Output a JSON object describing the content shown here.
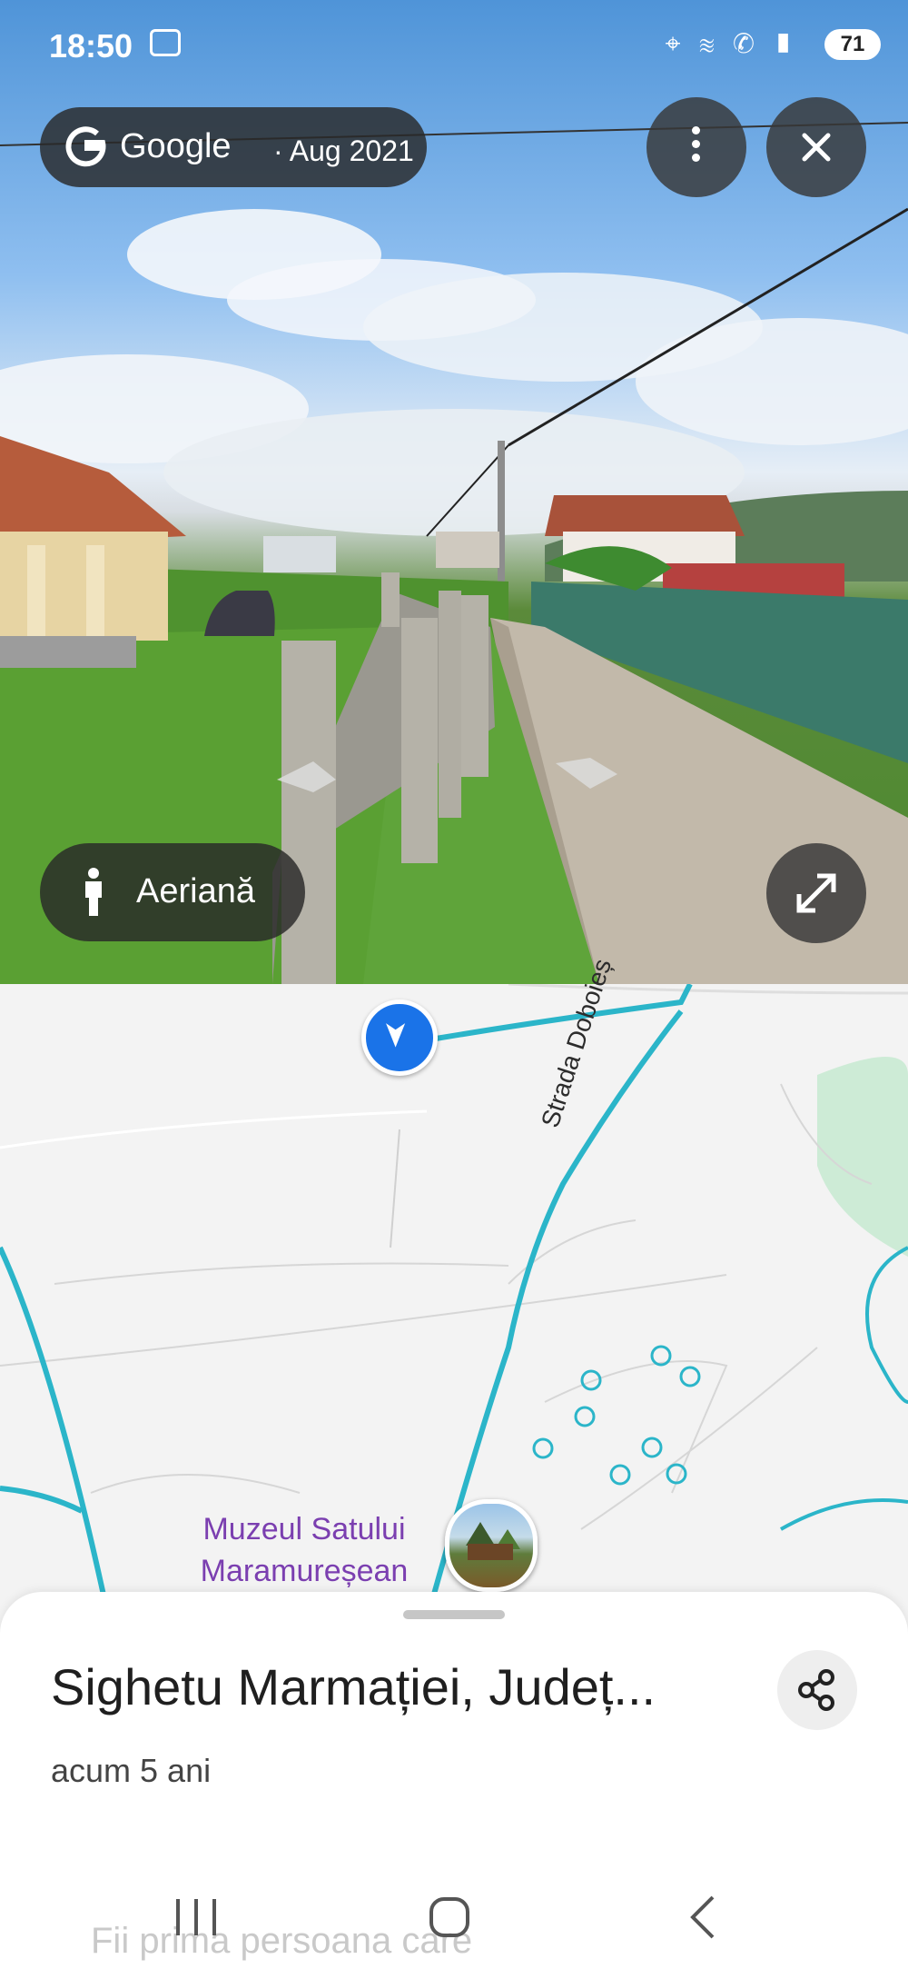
{
  "status_bar": {
    "time": "18:50",
    "battery": "71",
    "icons": "⌖ ≋ ✆ ▮"
  },
  "header": {
    "brand": "Google",
    "date": " · Aug 2021"
  },
  "street_view": {
    "mode_button_label": "Aeriană"
  },
  "map": {
    "street_label": "Strada Doboieș",
    "poi_line1": "Muzeul Satului",
    "poi_line2": "Maramureșean",
    "colors": {
      "road": "#2bb5c9",
      "park": "#cdebd6",
      "marker": "#1a73e8",
      "poi_text": "#7b3fb0"
    }
  },
  "sheet": {
    "place_title": "Sighetu Marmației, Județ...",
    "time_ago": "acum 5 ani",
    "faded_text": "Fii prima persoana care"
  }
}
